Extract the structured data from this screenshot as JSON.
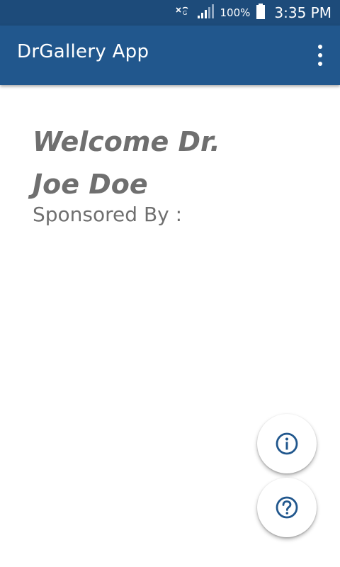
{
  "status_bar": {
    "battery_percent": "100%",
    "time": "3:35 PM",
    "icons": [
      "no-sim-icon",
      "signal-icon",
      "battery-icon"
    ]
  },
  "app_bar": {
    "title": "DrGallery App",
    "menu_icon": "overflow-menu-icon"
  },
  "content": {
    "welcome_line1": "Welcome Dr.",
    "welcome_line2": "Joe Doe",
    "sponsored_by": "Sponsored By :"
  },
  "fabs": [
    {
      "icon": "info-icon"
    },
    {
      "icon": "help-icon"
    }
  ],
  "colors": {
    "status_bar": "#1d4b7a",
    "app_bar": "#21578d",
    "text_gray": "#6f6f6f",
    "icon_blue": "#21578d"
  }
}
